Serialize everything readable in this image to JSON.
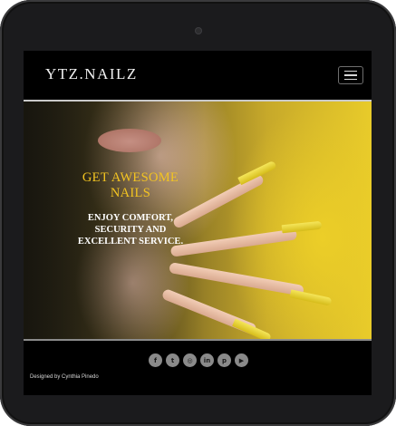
{
  "brand": "YTZ.NAILZ",
  "hero": {
    "title_line1": "GET AWESOME",
    "title_line2": "NAILS",
    "sub_line1": "ENJOY COMFORT,",
    "sub_line2": "SECURITY AND",
    "sub_line3": "EXCELLENT SERVICE."
  },
  "social": [
    {
      "name": "facebook-icon",
      "glyph": "f"
    },
    {
      "name": "twitter-icon",
      "glyph": "t"
    },
    {
      "name": "instagram-icon",
      "glyph": "◎"
    },
    {
      "name": "linkedin-icon",
      "glyph": "in"
    },
    {
      "name": "pinterest-icon",
      "glyph": "p"
    },
    {
      "name": "youtube-icon",
      "glyph": "▶"
    }
  ],
  "footer": {
    "credit": "Designed by Cynthia Pinedo"
  },
  "colors": {
    "title_accent": "#f3c421",
    "background": "#000000"
  }
}
